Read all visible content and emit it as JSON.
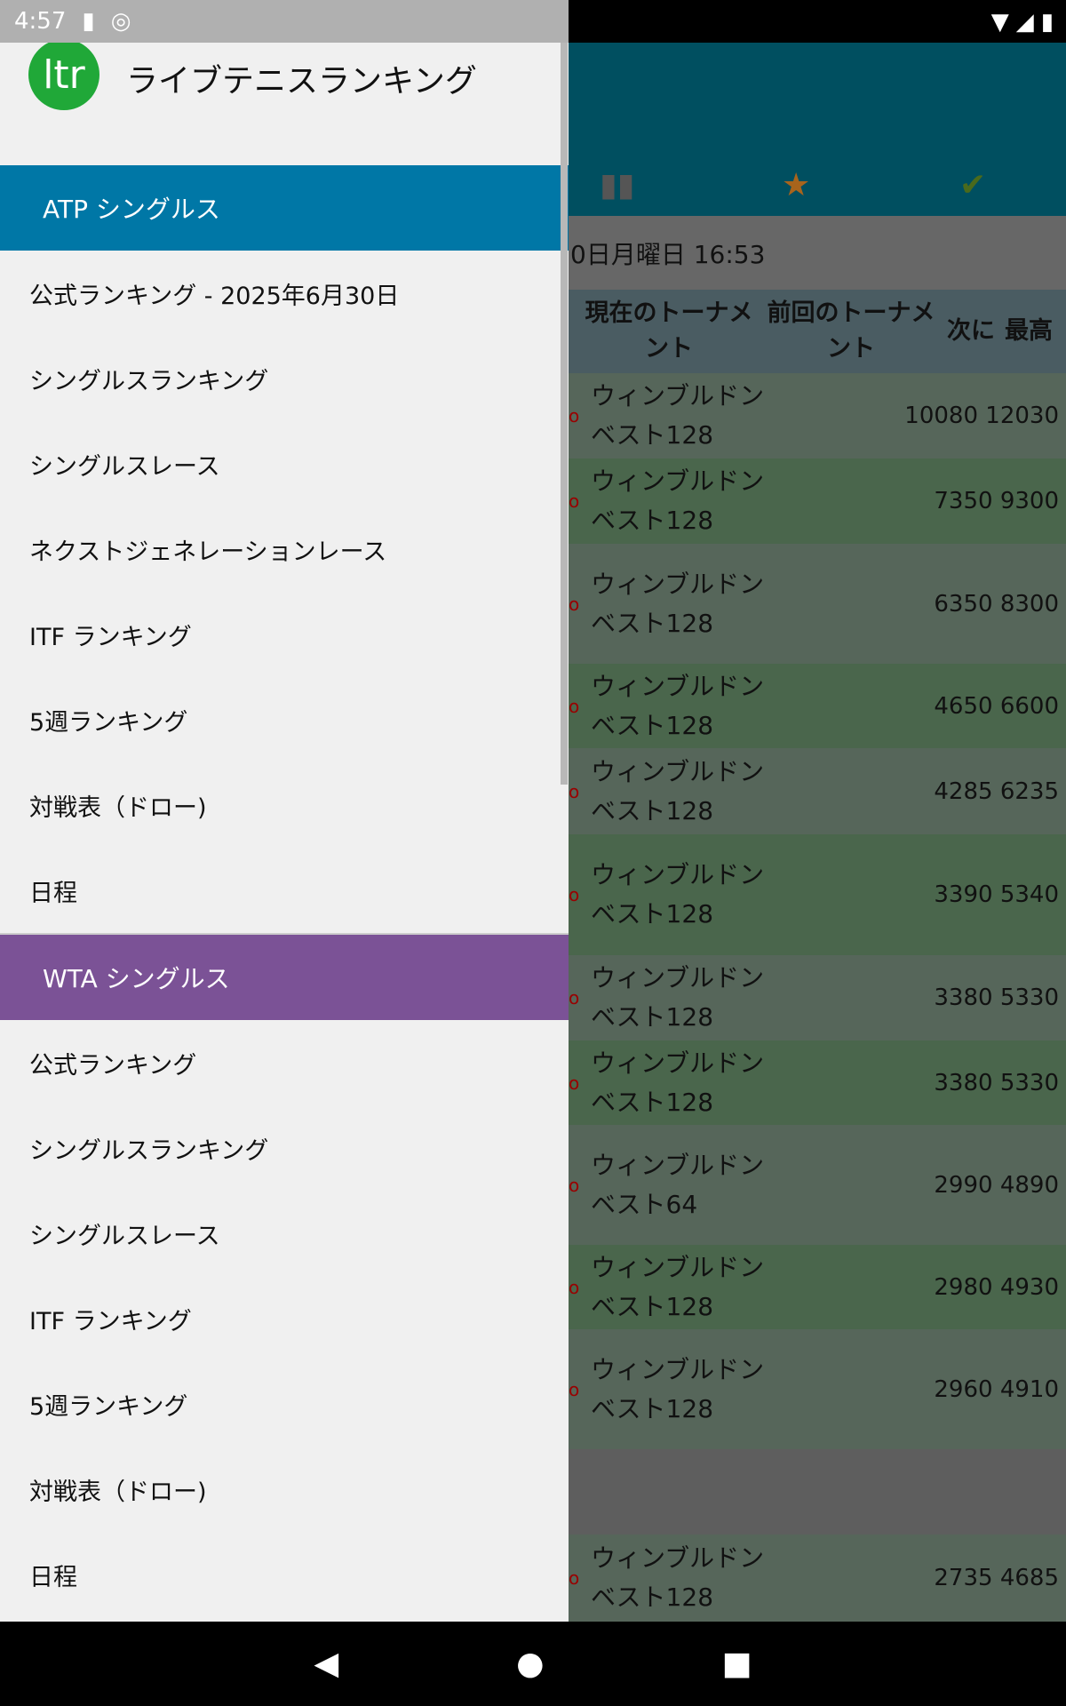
{
  "status": {
    "time": "4:57"
  },
  "drawer": {
    "app_name": "ライブテニスランキング",
    "logo_text": "ltr",
    "atp": {
      "title": "ATP シングルス",
      "color": "#0077a6",
      "items": [
        "公式ランキング - 2025年6月30日",
        "シングルスランキング",
        "シングルスレース",
        "ネクストジェネレーションレース",
        "ITF ランキング",
        "5週ランキング",
        "対戦表（ドロー)",
        "日程"
      ]
    },
    "wta": {
      "title": "WTA シングルス",
      "color": "#7b5296",
      "items": [
        "公式ランキング",
        "シングルスランキング",
        "シングルスレース",
        "ITF ランキング",
        "5週ランキング",
        "対戦表（ドロー)",
        "日程"
      ]
    }
  },
  "main": {
    "date": "0日月曜日 16:53",
    "columns": [
      "現在のトーナメント",
      "前回のトーナメント",
      "次に",
      "最高"
    ],
    "rows": [
      {
        "t": "ウィンブルドン ベスト128",
        "next": "10080",
        "max": "12030"
      },
      {
        "t": "ウィンブルドン ベスト128",
        "next": "7350",
        "max": "9300"
      },
      {
        "t": "ウィンブルドン ベスト128",
        "next": "6350",
        "max": "8300"
      },
      {
        "t": "ウィンブルドン ベスト128",
        "next": "4650",
        "max": "6600"
      },
      {
        "t": "ウィンブルドン ベスト128",
        "next": "4285",
        "max": "6235"
      },
      {
        "t": "ウィンブルドン ベスト128",
        "next": "3390",
        "max": "5340"
      },
      {
        "t": "ウィンブルドン ベスト128",
        "next": "3380",
        "max": "5330"
      },
      {
        "t": "ウィンブルドン ベスト128",
        "next": "3380",
        "max": "5330"
      },
      {
        "t": "ウィンブルドン ベスト64",
        "next": "2990",
        "max": "4890"
      },
      {
        "t": "ウィンブルドン ベスト128",
        "next": "2980",
        "max": "4930"
      },
      {
        "t": "ウィンブルドン ベスト128",
        "next": "2960",
        "max": "4910"
      },
      {
        "t": "",
        "next": "",
        "max": ""
      },
      {
        "t": "ウィンブルドン ベスト128",
        "next": "2735",
        "max": "4685"
      }
    ]
  }
}
